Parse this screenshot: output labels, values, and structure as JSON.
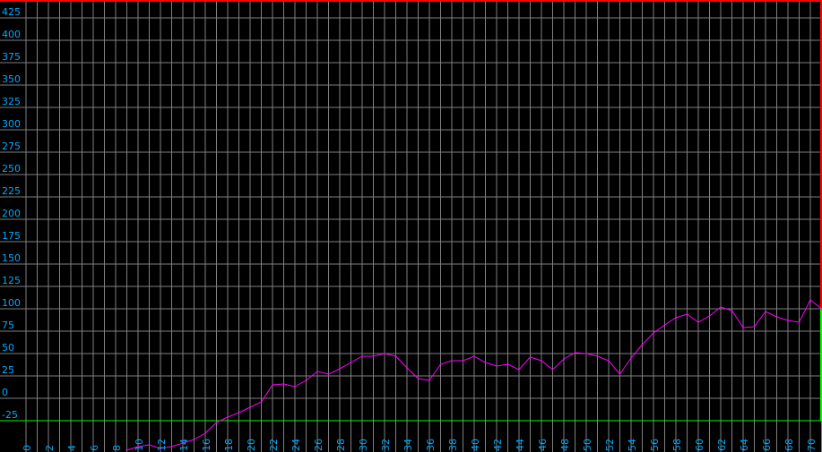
{
  "colors": {
    "background": "#000000",
    "grid": "#808080",
    "top_boundary": "#ff0000",
    "bottom_boundary": "#00ff00",
    "tick_text": "#00aaff",
    "series": "#ff00ff"
  },
  "chart_data": {
    "type": "line",
    "title": "",
    "xlabel": "",
    "ylabel": "",
    "grid": true,
    "xlim": [
      0,
      71
    ],
    "ylim": [
      -50,
      437
    ],
    "x_ticks": [
      0,
      2,
      4,
      6,
      8,
      10,
      12,
      14,
      16,
      18,
      20,
      22,
      24,
      26,
      28,
      30,
      32,
      34,
      36,
      38,
      40,
      42,
      44,
      46,
      48,
      50,
      52,
      54,
      56,
      58,
      60,
      62,
      64,
      66,
      68,
      70
    ],
    "y_ticks": [
      -25,
      0,
      25,
      50,
      75,
      100,
      125,
      150,
      175,
      200,
      225,
      250,
      275,
      300,
      325,
      350,
      375,
      400,
      425
    ],
    "y_limit_lines": [
      {
        "value": 437,
        "color": "#ff0000"
      },
      {
        "value": -25,
        "color": "#00ff00"
      }
    ],
    "series": [
      {
        "color": "#ff00ff",
        "x": [
          9,
          10,
          11,
          12,
          13,
          14,
          15,
          16,
          17,
          18,
          19,
          20,
          21,
          22,
          23,
          24,
          25,
          26,
          27,
          28,
          29,
          30,
          31,
          32,
          33,
          34,
          35,
          36,
          37,
          38,
          39,
          40,
          41,
          42,
          43,
          44,
          45,
          46,
          47,
          48,
          49,
          50,
          51,
          52,
          53,
          54,
          55,
          56,
          57,
          58,
          59,
          60,
          61,
          62,
          63,
          64,
          65,
          66,
          67,
          68,
          69,
          70,
          71
        ],
        "y": [
          -58,
          -54,
          -52,
          -56,
          -54,
          -50,
          -46,
          -39,
          -27,
          -21,
          -16,
          -10,
          -4,
          15,
          16,
          13,
          20,
          30,
          27,
          33,
          40,
          47,
          47,
          50,
          47,
          34,
          22,
          20,
          38,
          42,
          42,
          47,
          40,
          36,
          38,
          32,
          46,
          42,
          32,
          44,
          51,
          50,
          47,
          42,
          27,
          45,
          60,
          73,
          82,
          90,
          94,
          85,
          92,
          102,
          98,
          79,
          80,
          97,
          91,
          87,
          85,
          110,
          100
        ]
      }
    ]
  }
}
